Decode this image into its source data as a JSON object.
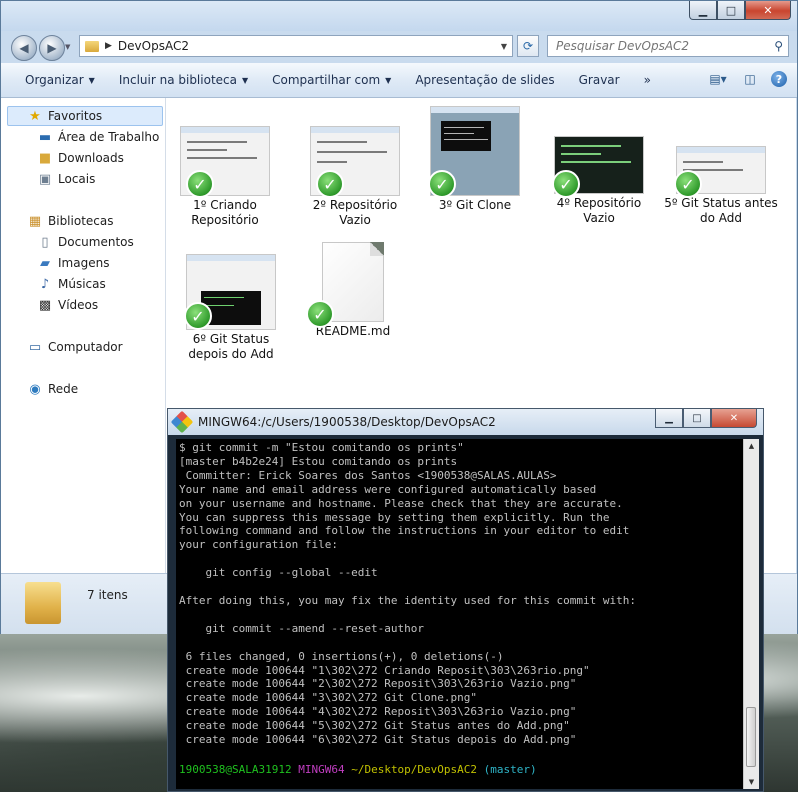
{
  "explorer": {
    "window_buttons": {
      "minimize": "▁",
      "maximize": "□",
      "close": "✕"
    },
    "address": {
      "path": "DevOpsAC2"
    },
    "search": {
      "placeholder": "Pesquisar DevOpsAC2"
    },
    "toolbar": {
      "organize": "Organizar",
      "include_library": "Incluir na biblioteca",
      "share": "Compartilhar com",
      "slideshow": "Apresentação de slides",
      "burn": "Gravar",
      "more": "»"
    },
    "nav": {
      "favorites": "Favoritos",
      "desktop": "Área de Trabalho",
      "downloads": "Downloads",
      "places": "Locais",
      "libraries": "Bibliotecas",
      "documents": "Documentos",
      "images": "Imagens",
      "music": "Músicas",
      "videos": "Vídeos",
      "computer": "Computador",
      "network": "Rede"
    },
    "files": [
      {
        "label": "1º Criando Repositório"
      },
      {
        "label": "2º Repositório Vazio"
      },
      {
        "label": "3º Git Clone"
      },
      {
        "label": "4º Repositório Vazio"
      },
      {
        "label": "5º Git Status antes do Add"
      },
      {
        "label": "6º Git Status depois do Add"
      },
      {
        "label": "README.md"
      }
    ],
    "details": {
      "count": "7 itens"
    }
  },
  "terminal": {
    "title": "MINGW64:/c/Users/1900538/Desktop/DevOpsAC2",
    "output": "$ git commit -m \"Estou comitando os prints\"\n[master b4b2e24] Estou comitando os prints\n Committer: Erick Soares dos Santos <1900538@SALAS.AULAS>\nYour name and email address were configured automatically based\non your username and hostname. Please check that they are accurate.\nYou can suppress this message by setting them explicitly. Run the\nfollowing command and follow the instructions in your editor to edit\nyour configuration file:\n\n    git config --global --edit\n\nAfter doing this, you may fix the identity used for this commit with:\n\n    git commit --amend --reset-author\n\n 6 files changed, 0 insertions(+), 0 deletions(-)\n create mode 100644 \"1\\302\\272 Criando Reposit\\303\\263rio.png\"\n create mode 100644 \"2\\302\\272 Reposit\\303\\263rio Vazio.png\"\n create mode 100644 \"3\\302\\272 Git Clone.png\"\n create mode 100644 \"4\\302\\272 Reposit\\303\\263rio Vazio.png\"\n create mode 100644 \"5\\302\\272 Git Status antes do Add.png\"\n create mode 100644 \"6\\302\\272 Git Status depois do Add.png\"",
    "prompt": {
      "user": "1900538@SALA31912",
      "system": "MINGW64",
      "path": "~/Desktop/DevOpsAC2",
      "branch": "(master)"
    }
  }
}
